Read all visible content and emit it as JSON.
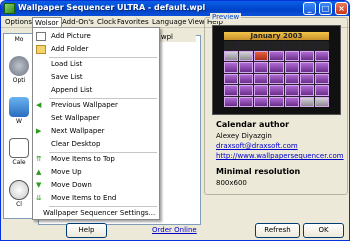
{
  "window": {
    "title": "Wallpaper Sequencer ULTRA - default.wpl"
  },
  "menubar": {
    "items": [
      "Options",
      "Wolsor",
      "Add-On's",
      "Clock",
      "Favorites",
      "Language",
      "View",
      "Help"
    ],
    "open": "Wolsor"
  },
  "dropdown": {
    "groups": [
      [
        "Add Picture",
        "Add Folder"
      ],
      [
        "Load List",
        "Save List",
        "Append List"
      ],
      [
        "Previous Wallpaper",
        "Set Wallpaper",
        "Next Wallpaper",
        "Clear Desktop"
      ],
      [
        "Move Items to Top",
        "Move Up",
        "Move Down",
        "Move Items to End"
      ],
      [
        "Wallpaper Sequencer Settings..."
      ]
    ]
  },
  "list": {
    "title": "default.wpl"
  },
  "sidebar": {
    "labels": [
      "Mo",
      "Opti",
      "W",
      "Cale",
      "Cl"
    ]
  },
  "preview": {
    "label": "Preview",
    "calendar_title": "January 2003",
    "author_heading": "Calendar author",
    "author_name": "Alexey Diyazgin",
    "author_email": "draxsoft@draxsoft.com",
    "author_url": "http://www.wallpapersequencer.com",
    "resolution_heading": "Minimal resolution",
    "resolution": "800x600"
  },
  "bottom": {
    "help": "Help",
    "order_online": "Order Online",
    "refresh": "Refresh",
    "ok": "OK"
  },
  "colors": {
    "title_bar": "#0a5fe8",
    "calendar_cells": "#9b4fc4",
    "calendar_header": "#e0ad3a"
  }
}
